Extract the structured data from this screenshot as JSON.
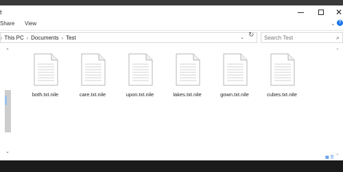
{
  "window": {
    "title_glyph": "t"
  },
  "ribbon": {
    "tabs": [
      "Share",
      "View"
    ],
    "help": "?"
  },
  "address": {
    "crumbs": [
      "This PC",
      "Documents",
      "Test"
    ]
  },
  "search": {
    "placeholder": "Search Test"
  },
  "files": [
    {
      "name": "both.txt.nile"
    },
    {
      "name": "care.txt.nile"
    },
    {
      "name": "upon.txt.nile"
    },
    {
      "name": "lakes.txt.nile"
    },
    {
      "name": "gown.txt.nile"
    },
    {
      "name": "cubes.txt.nile"
    }
  ],
  "colors": {
    "accent": "#1a73e8",
    "taskbar": "#1b1b1b"
  }
}
